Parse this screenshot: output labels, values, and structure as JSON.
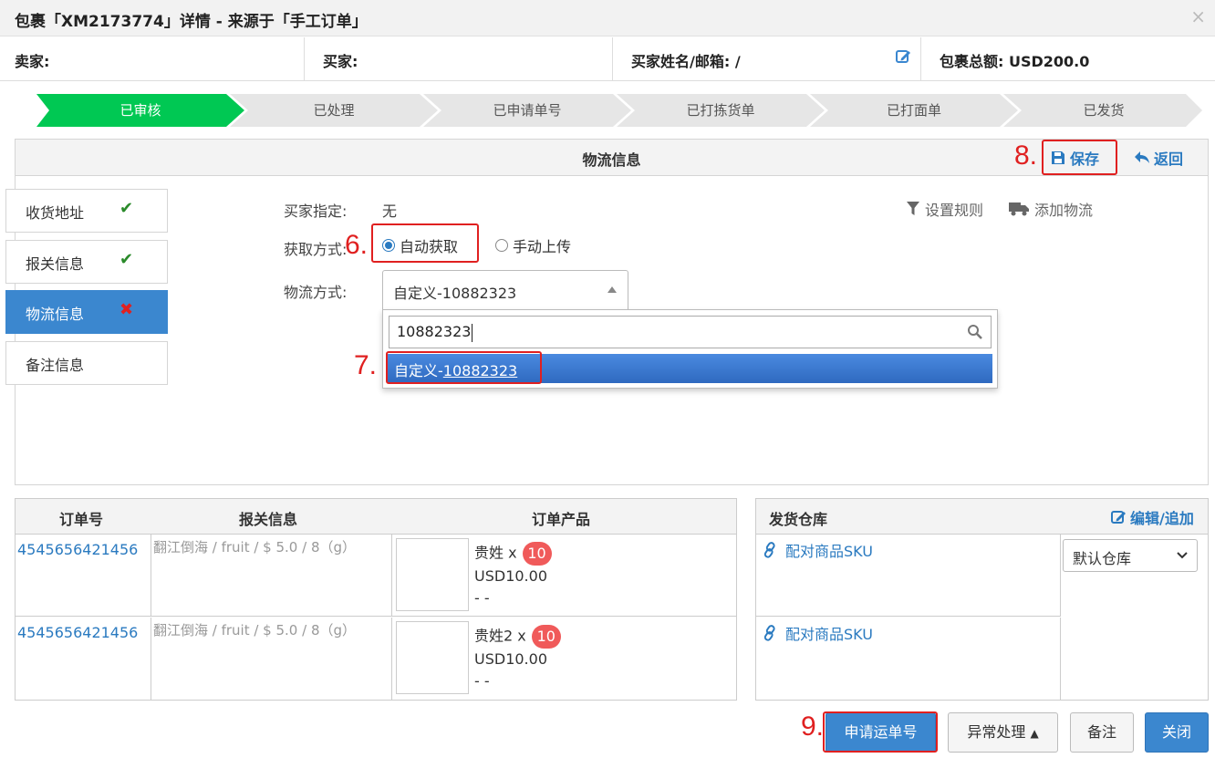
{
  "title": "包裹「XM2173774」详情 - 来源于「手工订单」",
  "close_glyph": "×",
  "info": {
    "seller": "卖家:",
    "buyer": "买家:",
    "buyer_name_email": "买家姓名/邮箱: /",
    "total": "包裹总额: USD200.0"
  },
  "steps": [
    "已审核",
    "已处理",
    "已申请单号",
    "已打拣货单",
    "已打面单",
    "已发货"
  ],
  "colors": {
    "accent": "#3b87cf",
    "step_active": "#00c853",
    "annotation": "#e02020",
    "badge": "#f05a5a"
  },
  "panel": {
    "title": "物流信息",
    "save": "保存",
    "back": "返回"
  },
  "annotations": {
    "a6": "6.",
    "a7": "7.",
    "a8": "8.",
    "a9": "9."
  },
  "side_tabs": [
    {
      "label": "收货地址",
      "mark": "✔"
    },
    {
      "label": "报关信息",
      "mark": "✔"
    },
    {
      "label": "物流信息",
      "mark": "✖"
    },
    {
      "label": "备注信息",
      "mark": ""
    }
  ],
  "form": {
    "buyer_specified_label": "买家指定:",
    "buyer_specified_value": "无",
    "fetch_label": "获取方式:",
    "auto": "自动获取",
    "manual": "手动上传",
    "logistics_label": "物流方式:",
    "logistics_value": "自定义-10882323",
    "search_value": "10882323",
    "option_prefix": "自定义-",
    "option_match": "10882323"
  },
  "tools": {
    "rules": "设置规则",
    "add_logistics": "添加物流"
  },
  "orders": {
    "headers": {
      "order_no": "订单号",
      "declaration": "报关信息",
      "products": "订单产品"
    },
    "rows": [
      {
        "order_no": "4545656421456",
        "declaration": "翻江倒海 / fruit / $ 5.0 / 8（g）",
        "product": "贵姓 x",
        "qty": "10",
        "price": "USD10.00",
        "extra": "- -"
      },
      {
        "order_no": "4545656421456",
        "declaration": "翻江倒海 / fruit / $ 5.0 / 8（g）",
        "product": "贵姓2 x",
        "qty": "10",
        "price": "USD10.00",
        "extra": "- -"
      }
    ]
  },
  "warehouse": {
    "header": "发货仓库",
    "edit": "编辑/追加",
    "sku_link": "配对商品SKU",
    "selected": "默认仓库"
  },
  "buttons": {
    "apply": "申请运单号",
    "exception": "异常处理",
    "exception_caret": "▲",
    "note": "备注",
    "close": "关闭"
  }
}
